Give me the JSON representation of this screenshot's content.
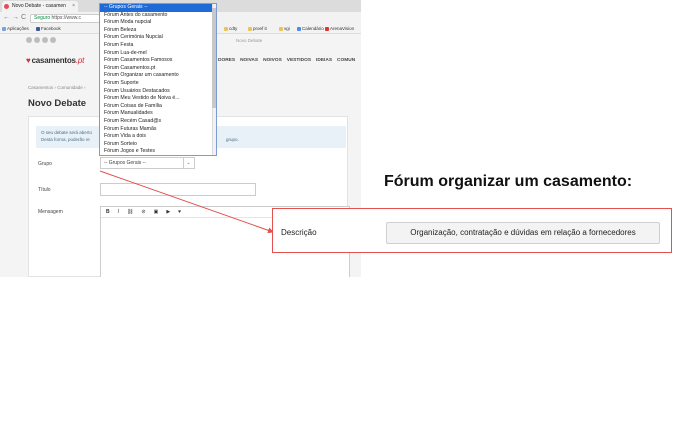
{
  "browser": {
    "tab_title": "Novo Debate - casamen",
    "tab_close": "×",
    "nav_back": "←",
    "nav_forward": "→",
    "nav_reload": "C",
    "secure_label": "Seguro",
    "url": "https://www.c",
    "bookmarks": [
      "Aplicações",
      "Facebook",
      "cdty",
      "proef it",
      "vgi",
      "Calendário",
      "ArenaVision"
    ]
  },
  "site": {
    "logo_text": "casamentos",
    "logo_suffix": ".pt",
    "top_right_label": "Novo Debate",
    "nav_items": [
      "DORES",
      "NOIVAS",
      "NOIVOS",
      "VESTIDOS",
      "IDEIAS",
      "COMUN"
    ],
    "breadcrumb": "Casamentos  ›  Comunidade  ›",
    "page_title": "Novo Debate"
  },
  "form": {
    "info_line1": "O seu debate será aberto",
    "info_line2": "Desta forma, poderão re",
    "info_right": "grupo.",
    "grupo_label": "Grupo",
    "grupo_value": "-- Grupos Gerais --",
    "titulo_label": "Título",
    "mensagem_label": "Mensagem",
    "editor_buttons": [
      "B",
      "I",
      "⛓",
      "⊘",
      "▣",
      "▶",
      "♥"
    ]
  },
  "dropdown": {
    "options": [
      "-- Grupos Gerais --",
      "Fórum Antes do casamento",
      "Fórum Moda nupcial",
      "Fórum Beleza",
      "Fórum Cerimónia Nupcial",
      "Fórum Festa",
      "Fórum Lua-de-mel",
      "Fórum Casamentos Famosos",
      "Fórum Casamentos.pt",
      "Fórum Organizar um casamento",
      "Fórum Suporte",
      "Fórum Usuários Destacados",
      "Fórum Meu Vestido de Noiva é...",
      "Fórum Coisas de Família",
      "Fórum Manualidades",
      "Fórum Recém Casad@s",
      "Fórum Futuras Mamãs",
      "Fórum Vida a dois",
      "Fórum Sorteio",
      "Fórum Jogos e Testes"
    ],
    "selected_index": 0
  },
  "annotation": {
    "heading": "Fórum organizar um casamento:",
    "field_label": "Descrição",
    "field_value": "Organização, contratação e dúvidas em relação a fornecedores",
    "accent_color": "#e25050"
  }
}
